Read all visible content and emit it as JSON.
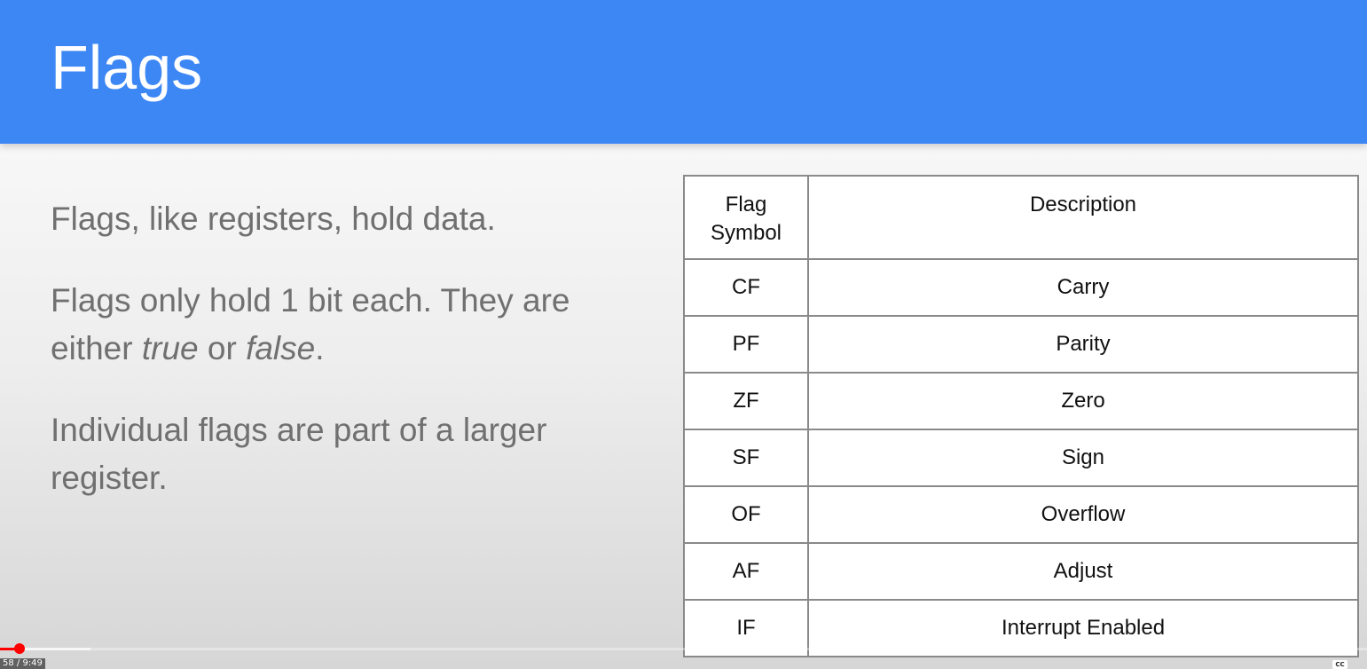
{
  "slide": {
    "title": "Flags",
    "paragraphs": {
      "p1": "Flags, like registers, hold data.",
      "p2_before": "Flags only hold 1 bit each. They are either ",
      "p2_true": "true",
      "p2_mid": " or ",
      "p2_false": "false",
      "p2_after": ".",
      "p3": "Individual flags are part of a larger register."
    },
    "table": {
      "header_symbol_line1": "Flag",
      "header_symbol_line2": "Symbol",
      "header_description": "Description",
      "rows": [
        {
          "symbol": "CF",
          "description": "Carry"
        },
        {
          "symbol": "PF",
          "description": "Parity"
        },
        {
          "symbol": "ZF",
          "description": "Zero"
        },
        {
          "symbol": "SF",
          "description": "Sign"
        },
        {
          "symbol": "OF",
          "description": "Overflow"
        },
        {
          "symbol": "AF",
          "description": "Adjust"
        },
        {
          "symbol": "IF",
          "description": "Interrupt Enabled"
        }
      ]
    }
  },
  "player": {
    "time": "58 / 9:49",
    "cc_label": "CC",
    "played_fraction": 0.014,
    "buffered_fraction": 0.066
  },
  "colors": {
    "header_blue": "#3d87f5",
    "progress_red": "#ff0000"
  }
}
